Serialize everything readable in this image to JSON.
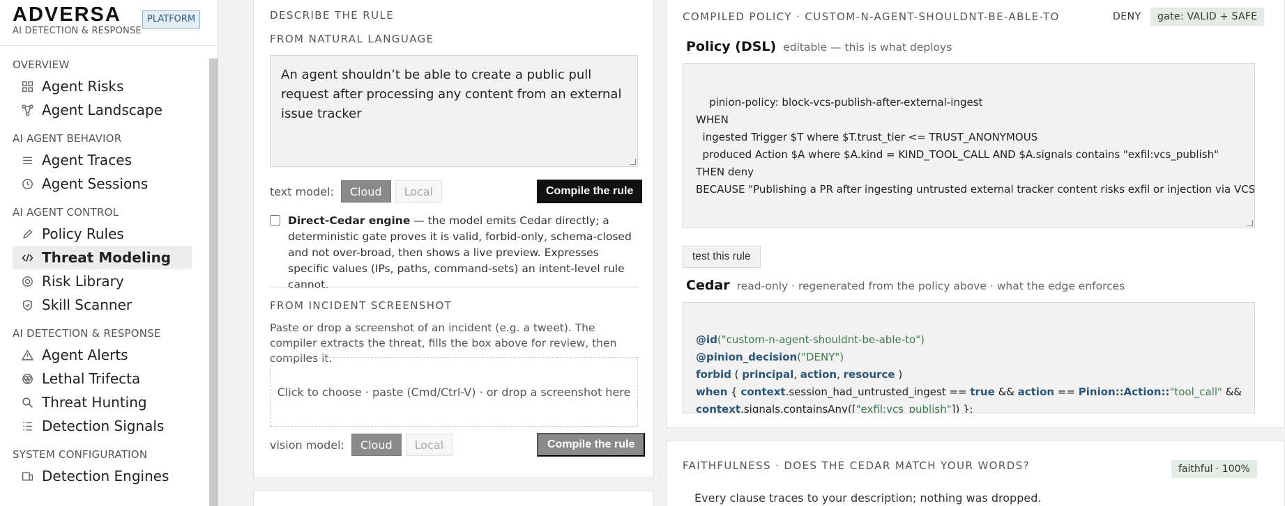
{
  "brand": {
    "logo": "ADVERSA",
    "tagline": "AI DETECTION & RESPONSE",
    "badge": "PLATFORM"
  },
  "nav": {
    "sections": [
      {
        "label": "OVERVIEW",
        "items": [
          {
            "label": "Agent Risks",
            "icon": "grid-icon"
          },
          {
            "label": "Agent Landscape",
            "icon": "network-icon"
          }
        ]
      },
      {
        "label": "AI AGENT BEHAVIOR",
        "items": [
          {
            "label": "Agent Traces",
            "icon": "list-icon"
          },
          {
            "label": "Agent Sessions",
            "icon": "clock-icon"
          }
        ]
      },
      {
        "label": "AI AGENT CONTROL",
        "items": [
          {
            "label": "Policy Rules",
            "icon": "pencil-icon"
          },
          {
            "label": "Threat Modeling",
            "icon": "code-icon",
            "active": true
          },
          {
            "label": "Risk Library",
            "icon": "target-icon"
          },
          {
            "label": "Skill Scanner",
            "icon": "shield-icon"
          }
        ]
      },
      {
        "label": "AI DETECTION & RESPONSE",
        "items": [
          {
            "label": "Agent Alerts",
            "icon": "warning-icon"
          },
          {
            "label": "Lethal Trifecta",
            "icon": "trifecta-icon"
          },
          {
            "label": "Threat Hunting",
            "icon": "search-icon"
          },
          {
            "label": "Detection Signals",
            "icon": "signals-icon"
          }
        ]
      },
      {
        "label": "SYSTEM CONFIGURATION",
        "items": [
          {
            "label": "Detection Engines",
            "icon": "engine-icon"
          }
        ]
      }
    ]
  },
  "describe": {
    "eyebrow": "DESCRIBE THE RULE",
    "natural_heading": "FROM NATURAL LANGUAGE",
    "rule_text": "An agent shouldn’t be able to create a public pull request after processing any content from an external issue tracker",
    "text_model_label": "text model:",
    "cloud_label": "Cloud",
    "local_label": "Local",
    "compile_label": "Compile the rule",
    "direct_cedar_title": "Direct-Cedar engine",
    "direct_cedar_body": " — the model emits Cedar directly; a deterministic gate proves it is valid, forbid-only, schema-closed and not over-broad, then shows a live preview. Expresses specific values (IPs, paths, command-sets) an intent-level rule cannot.",
    "screenshot_heading": "FROM INCIDENT SCREENSHOT",
    "screenshot_help": "Paste or drop a screenshot of an incident (e.g. a tweet). The compiler extracts the threat, fills the box above for review, then compiles it.",
    "dropzone_text": "Click to choose · paste (Cmd/Ctrl-V) · or drop a screenshot here",
    "vision_model_label": "vision model:",
    "vision_cloud_label": "Cloud",
    "vision_local_label": "Local",
    "vision_compile_label": "Compile the rule"
  },
  "compiled": {
    "title": "COMPILED POLICY · CUSTOM-N-AGENT-SHOULDNT-BE-ABLE-TO",
    "decision": "DENY",
    "gate": "gate: VALID + SAFE",
    "dsl_heading": "Policy (DSL)",
    "dsl_sub": "editable — this is what deploys",
    "dsl_code": "pinion-policy: block-vcs-publish-after-external-ingest\nWHEN\n  ingested Trigger $T where $T.trust_tier <= TRUST_ANONYMOUS\n  produced Action $A where $A.kind = KIND_TOOL_CALL AND $A.signals contains \"exfil:vcs_publish\"\nTHEN deny\nBECAUSE \"Publishing a PR after ingesting untrusted external tracker content risks exfil or injection via VCS.\"",
    "test_label": "test this rule",
    "cedar_heading": "Cedar",
    "cedar_sub": "read-only · regenerated from the policy above · what the edge enforces",
    "cedar": {
      "l1_kw": "@id",
      "l1_str": "(\"custom-n-agent-shouldnt-be-able-to\")",
      "l2_kw": "@pinion_decision",
      "l2_str": "(\"DENY\")",
      "l3_kw1": "forbid",
      "l3_p1": " ( ",
      "l3_kw2": "principal",
      "l3_p2": ", ",
      "l3_kw3": "action",
      "l3_p3": ", ",
      "l3_kw4": "resource",
      "l3_p4": " )",
      "l4_kw1": "when",
      "l4_p1": " { ",
      "l4_kw2": "context",
      "l4_p2": ".session_had_untrusted_ingest == ",
      "l4_kw3": "true",
      "l4_p3": " && ",
      "l4_kw4": "action",
      "l4_p4": " == ",
      "l4_kw5": "Pinion::Action::",
      "l4_str": "\"tool_call\"",
      "l4_p5": " &&",
      "l5_kw1": "context",
      "l5_p1": ".signals.containsAny([",
      "l5_str": "\"exfil:vcs_publish\"",
      "l5_p2": "]) };"
    }
  },
  "faithfulness": {
    "title": "FAITHFULNESS · DOES THE CEDAR MATCH YOUR WORDS?",
    "tag": "faithful · 100%",
    "text": "Every clause traces to your description; nothing was dropped."
  }
}
